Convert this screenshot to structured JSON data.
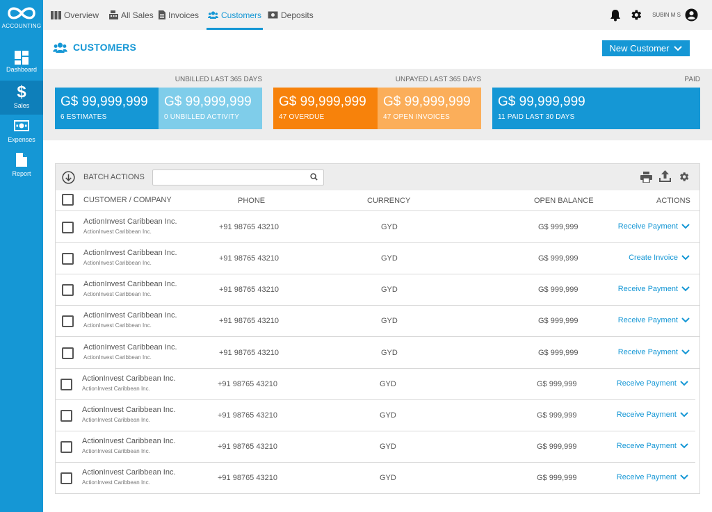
{
  "brand": {
    "logo_text": "ACCOUNTING"
  },
  "sidebar": {
    "items": [
      {
        "label": "Dashboard",
        "icon": "dashboard-grid-icon"
      },
      {
        "label": "Sales",
        "icon": "dollar-icon"
      },
      {
        "label": "Expenses",
        "icon": "cash-icon"
      },
      {
        "label": "Report",
        "icon": "document-icon"
      }
    ],
    "active": "Sales"
  },
  "topnav": {
    "tabs": [
      {
        "label": "Overview",
        "icon": "columns-icon"
      },
      {
        "label": "All Sales",
        "icon": "register-icon"
      },
      {
        "label": "Invoices",
        "icon": "invoice-icon"
      },
      {
        "label": "Customers",
        "icon": "users-icon"
      },
      {
        "label": "Deposits",
        "icon": "deposit-icon"
      }
    ],
    "active": "Customers"
  },
  "user": {
    "name": "SUBIN M S"
  },
  "page": {
    "title": "CUSTOMERS",
    "new_button": "New Customer"
  },
  "summary": {
    "unbilled_label": "UNBILLED LAST 365 DAYS",
    "unpayed_label": "UNPAYED LAST 365 DAYS",
    "paid_label": "PAID",
    "cards": [
      {
        "amount": "G$ 99,999,999",
        "sub": "6 ESTIMATES",
        "color": "#1597d5"
      },
      {
        "amount": "G$ 99,999,999",
        "sub": "0 UNBILLED ACTIVITY",
        "color": "#7fcdea"
      },
      {
        "amount": "G$ 99,999,999",
        "sub": "47 OVERDUE",
        "color": "#f7820b"
      },
      {
        "amount": "G$ 99,999,999",
        "sub": "47 OPEN INVOICES",
        "color": "#fbae5a"
      },
      {
        "amount": "G$ 99,999,999",
        "sub": "11 PAID LAST 30 DAYS",
        "color": "#1597d5"
      }
    ]
  },
  "table": {
    "batch_label": "BATCH ACTIONS",
    "search": {
      "value": "",
      "placeholder": ""
    },
    "headers": {
      "customer": "CUSTOMER / COMPANY",
      "phone": "PHONE",
      "currency": "CURRENCY",
      "balance": "OPEN BALANCE",
      "actions": "ACTIONS"
    },
    "rows": [
      {
        "name": "ActionInvest Caribbean Inc.",
        "company": "ActionInvest Caribbean Inc.",
        "phone": "+91 98765 43210",
        "currency": "GYD",
        "balance": "G$ 999,999",
        "action": "Receive Payment"
      },
      {
        "name": "ActionInvest Caribbean Inc.",
        "company": "ActionInvest Caribbean Inc.",
        "phone": "+91 98765 43210",
        "currency": "GYD",
        "balance": "G$ 999,999",
        "action": "Create Invoice"
      },
      {
        "name": "ActionInvest Caribbean Inc.",
        "company": "ActionInvest Caribbean Inc.",
        "phone": "+91 98765 43210",
        "currency": "GYD",
        "balance": "G$ 999,999",
        "action": "Receive Payment"
      },
      {
        "name": "ActionInvest Caribbean Inc.",
        "company": "ActionInvest Caribbean Inc.",
        "phone": "+91 98765 43210",
        "currency": "GYD",
        "balance": "G$ 999,999",
        "action": "Receive Payment"
      },
      {
        "name": "ActionInvest Caribbean Inc.",
        "company": "ActionInvest Caribbean Inc.",
        "phone": "+91 98765 43210",
        "currency": "GYD",
        "balance": "G$ 999,999",
        "action": "Receive Payment"
      },
      {
        "name": "ActionInvest Caribbean Inc.",
        "company": "ActionInvest Caribbean Inc.",
        "phone": "+91 98765 43210",
        "currency": "GYD",
        "balance": "G$ 999,999",
        "action": "Receive Payment"
      },
      {
        "name": "ActionInvest Caribbean Inc.",
        "company": "ActionInvest Caribbean Inc.",
        "phone": "+91 98765 43210",
        "currency": "GYD",
        "balance": "G$ 999,999",
        "action": "Receive Payment"
      },
      {
        "name": "ActionInvest Caribbean Inc.",
        "company": "ActionInvest Caribbean Inc.",
        "phone": "+91 98765 43210",
        "currency": "GYD",
        "balance": "G$ 999,999",
        "action": "Receive Payment"
      },
      {
        "name": "ActionInvest Caribbean Inc.",
        "company": "ActionInvest Caribbean Inc.",
        "phone": "+91 98765 43210",
        "currency": "GYD",
        "balance": "G$ 999,999",
        "action": "Receive Payment"
      }
    ]
  },
  "colors": {
    "accent": "#1597d5",
    "sidebar_active": "#0e7fba",
    "band": "#ededed"
  }
}
